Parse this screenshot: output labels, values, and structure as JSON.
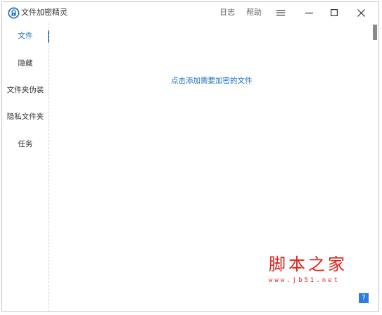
{
  "app": {
    "title": "文件加密精灵",
    "log_label": "日志",
    "help_label": "帮助",
    "menu_icon": "hamburger-icon",
    "minimize_icon": "minimize-icon",
    "maximize_icon": "maximize-icon",
    "close_icon": "close-icon",
    "logo_icon": "lock-icon",
    "accent_color": "#1e6fbf"
  },
  "sidebar": {
    "items": [
      {
        "label": "文件",
        "active": true
      },
      {
        "label": "隐藏",
        "active": false
      },
      {
        "label": "文件夹伪装",
        "active": false
      },
      {
        "label": "隐私文件夹",
        "active": false
      },
      {
        "label": "任务",
        "active": false
      }
    ]
  },
  "main": {
    "add_file_prompt": "点击添加需要加密的文件"
  },
  "watermark": {
    "title": "脚本之家",
    "url": "www.jb51.net"
  },
  "help_button": {
    "label": "?"
  }
}
